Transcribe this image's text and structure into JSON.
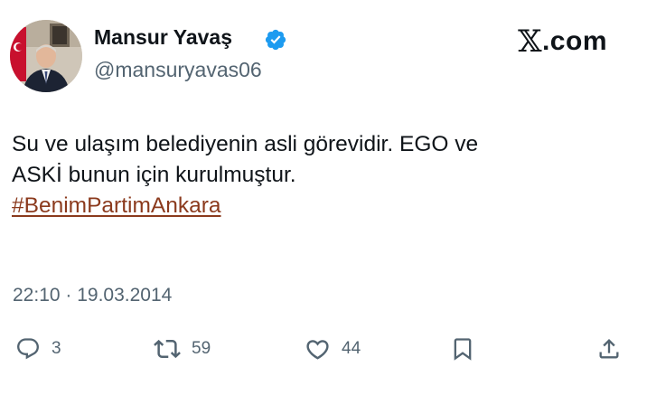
{
  "header": {
    "display_name": "Mansur Yavaş",
    "handle": "@mansuryavas06",
    "brand": "𝕏.com",
    "brand_letter": "𝕏",
    "brand_suffix": ".com"
  },
  "tweet": {
    "text_line_1": "Su ve ulaşım belediyenin asli görevidir.  EGO ve",
    "text_line_2": "ASKİ bunun için kurulmuştur.",
    "hashtag": "#BenimPartimAnkara",
    "timestamp": "22:10 · 19.03.2014"
  },
  "actions": {
    "replies": "3",
    "reposts": "59",
    "likes": "44"
  },
  "icons": {
    "verified": "verified-badge-icon",
    "reply": "reply-icon",
    "repost": "repost-icon",
    "like": "heart-icon",
    "bookmark": "bookmark-icon",
    "share": "share-icon"
  },
  "colors": {
    "verified_blue": "#1d9bf0",
    "hashtag": "#8b3a1d",
    "secondary_text": "#536471",
    "primary_text": "#0f1419"
  }
}
